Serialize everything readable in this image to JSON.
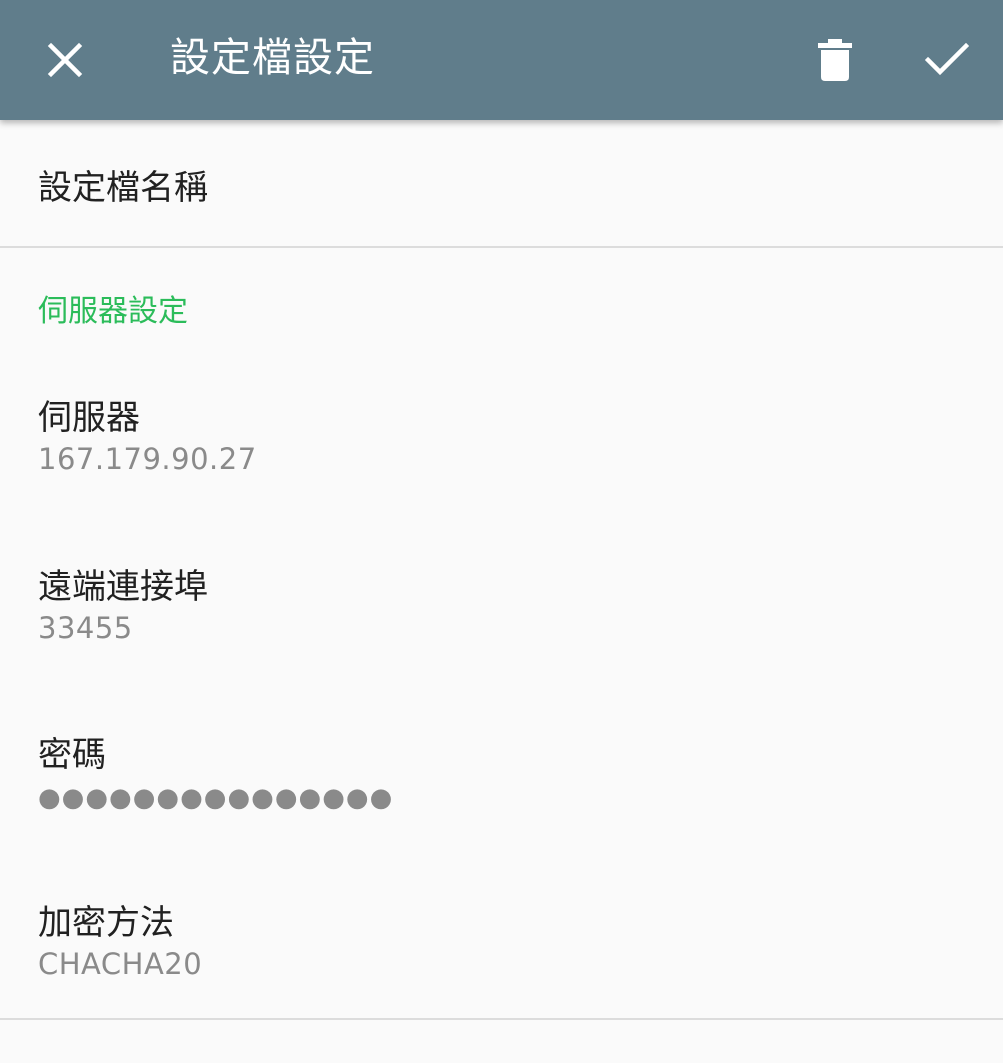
{
  "toolbar": {
    "title": "設定檔設定",
    "close_icon": "close-icon",
    "delete_icon": "trash-icon",
    "confirm_icon": "check-icon",
    "background_color": "#607d8b"
  },
  "profile": {
    "name_label": "設定檔名稱"
  },
  "server_section": {
    "header": "伺服器設定",
    "header_color": "#2bbc5a",
    "items": [
      {
        "title": "伺服器",
        "summary": "167.179.90.27"
      },
      {
        "title": "遠端連接埠",
        "summary": "33455"
      },
      {
        "title": "密碼",
        "summary": "●●●●●●●●●●●●●●●"
      },
      {
        "title": "加密方法",
        "summary": "CHACHA20"
      }
    ]
  }
}
